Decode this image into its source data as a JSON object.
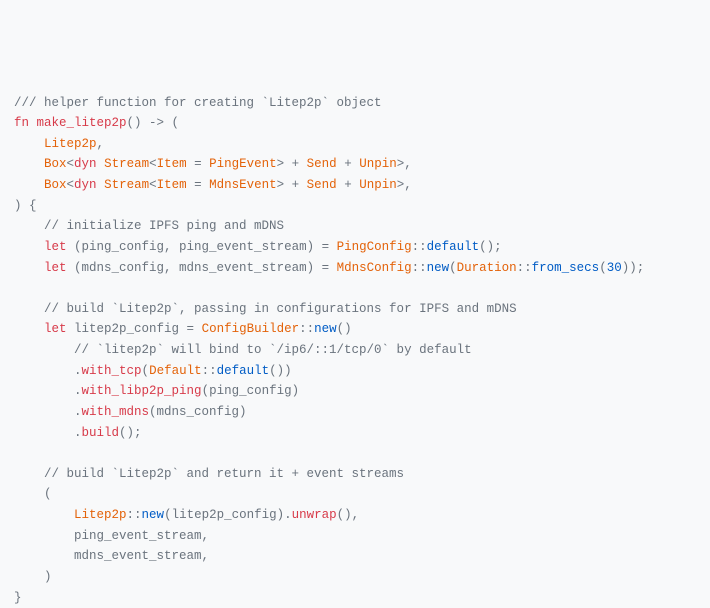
{
  "c01": "/// helper function for creating `Litep2p` object",
  "c02_kw": "fn",
  "c02_fn": "make_litep2p",
  "c02_rest": "() -> (",
  "c03_ty": "Litep2p",
  "c03_rest": ",",
  "c04a": "Box",
  "c04b": "<",
  "c04c": "dyn",
  "c04d": " ",
  "c04e": "Stream",
  "c04f": "<",
  "c04g": "Item",
  "c04h": " = ",
  "c04i": "PingEvent",
  "c04j": "> + ",
  "c04k": "Send",
  "c04l": " + ",
  "c04m": "Unpin",
  "c04n": ">,",
  "c05a": "Box",
  "c05b": "<",
  "c05c": "dyn",
  "c05d": " ",
  "c05e": "Stream",
  "c05f": "<",
  "c05g": "Item",
  "c05h": " = ",
  "c05i": "MdnsEvent",
  "c05j": "> + ",
  "c05k": "Send",
  "c05l": " + ",
  "c05m": "Unpin",
  "c05n": ">,",
  "c06": ") {",
  "c07": "    // initialize IPFS ping and mDNS",
  "c08_kw": "let",
  "c08_a": " (ping_config, ping_event_stream) = ",
  "c08_t": "PingConfig",
  "c08_b": "::",
  "c08_m": "default",
  "c08_c": "();",
  "c09_kw": "let",
  "c09_a": " (mdns_config, mdns_event_stream) = ",
  "c09_t": "MdnsConfig",
  "c09_b": "::",
  "c09_m": "new",
  "c09_c": "(",
  "c09_t2": "Duration",
  "c09_d": "::",
  "c09_m2": "from_secs",
  "c09_e": "(",
  "c09_n": "30",
  "c09_f": "));",
  "c10": "",
  "c11": "    // build `Litep2p`, passing in configurations for IPFS and mDNS",
  "c12_kw": "let",
  "c12_a": " litep2p_config = ",
  "c12_t": "ConfigBuilder",
  "c12_b": "::",
  "c12_m": "new",
  "c12_c": "()",
  "c13": "        // `litep2p` will bind to `/ip6/::1/tcp/0` by default",
  "c14_a": ".",
  "c14_m": "with_tcp",
  "c14_b": "(",
  "c14_t": "Default",
  "c14_c": "::",
  "c14_m2": "default",
  "c14_d": "())",
  "c15_a": ".",
  "c15_m": "with_libp2p_ping",
  "c15_b": "(ping_config)",
  "c16_a": ".",
  "c16_m": "with_mdns",
  "c16_b": "(mdns_config)",
  "c17_a": ".",
  "c17_m": "build",
  "c17_b": "();",
  "c18": "",
  "c19": "    // build `Litep2p` and return it + event streams",
  "c20": "    (",
  "c21a": "Litep2p",
  "c21b": "::",
  "c21c": "new",
  "c21d": "(litep2p_config).",
  "c21e": "unwrap",
  "c21f": "(),",
  "c22": "        ping_event_stream,",
  "c23": "        mdns_event_stream,",
  "c24": "    )",
  "c25": "}"
}
